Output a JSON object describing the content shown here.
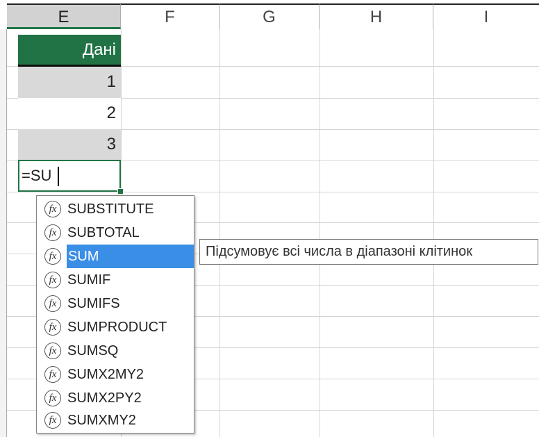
{
  "columns": [
    "E",
    "F",
    "G",
    "H",
    "I"
  ],
  "cells": {
    "header": "Дані",
    "values": [
      "1",
      "2",
      "3"
    ]
  },
  "formula_input": "=SU",
  "autocomplete": {
    "items": [
      "SUBSTITUTE",
      "SUBTOTAL",
      "SUM",
      "SUMIF",
      "SUMIFS",
      "SUMPRODUCT",
      "SUMSQ",
      "SUMX2MY2",
      "SUMX2PY2",
      "SUMXMY2"
    ],
    "selected": "SUM",
    "icon": "function-fx-icon"
  },
  "tooltip": "Підсумовує всі числа в діапазоні клітинок",
  "colors": {
    "accent": "#217346",
    "selection": "#3a8ee6",
    "band": "#d9d9d9"
  }
}
